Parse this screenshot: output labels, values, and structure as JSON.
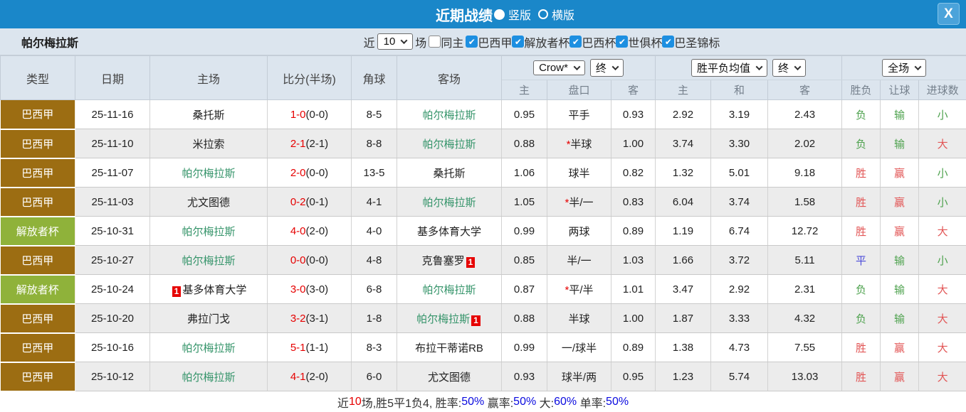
{
  "titlebar": {
    "title": "近期战绩",
    "radio_vertical": "竖版",
    "radio_horizontal": "横版",
    "vertical_selected": true,
    "close_label": "X"
  },
  "filter": {
    "team": "帕尔梅拉斯",
    "near_label": "近",
    "near_value": "10",
    "games_label": "场",
    "same_home_label": "同主",
    "same_home_checked": false,
    "leagues": [
      {
        "label": "巴西甲",
        "checked": true
      },
      {
        "label": "解放者杯",
        "checked": true
      },
      {
        "label": "巴西杯",
        "checked": true
      },
      {
        "label": "世俱杯",
        "checked": true
      },
      {
        "label": "巴圣锦标",
        "checked": true
      }
    ]
  },
  "table": {
    "left_headers": [
      "类型",
      "日期",
      "主场",
      "比分(半场)",
      "角球",
      "客场"
    ],
    "selectors": {
      "odds_company": "Crow*",
      "odds_time": "终",
      "europe": "胜平负均值",
      "europe_time": "终",
      "scope": "全场"
    },
    "sub_headers": [
      "主",
      "盘口",
      "客",
      "主",
      "和",
      "客",
      "胜负",
      "让球",
      "进球数"
    ],
    "rows": [
      {
        "type": "巴西甲",
        "type_key": "league",
        "date": "25-11-16",
        "home": "桑托斯",
        "home_team": false,
        "home_badge": "",
        "score": "1-0",
        "half": "(0-0)",
        "corner": "8-5",
        "away": "帕尔梅拉斯",
        "away_team": true,
        "away_badge": "",
        "asia_home": "0.95",
        "handicap_star": "",
        "handicap": "平手",
        "asia_away": "0.93",
        "avg_home": "2.92",
        "avg_draw": "3.19",
        "avg_away": "2.43",
        "result": "负",
        "handicap_result": "输",
        "goals": "小"
      },
      {
        "type": "巴西甲",
        "type_key": "league",
        "date": "25-11-10",
        "home": "米拉索",
        "home_team": false,
        "home_badge": "",
        "score": "2-1",
        "half": "(2-1)",
        "corner": "8-8",
        "away": "帕尔梅拉斯",
        "away_team": true,
        "away_badge": "",
        "asia_home": "0.88",
        "handicap_star": "*",
        "handicap": "半球",
        "asia_away": "1.00",
        "avg_home": "3.74",
        "avg_draw": "3.30",
        "avg_away": "2.02",
        "result": "负",
        "handicap_result": "输",
        "goals": "大"
      },
      {
        "type": "巴西甲",
        "type_key": "league",
        "date": "25-11-07",
        "home": "帕尔梅拉斯",
        "home_team": true,
        "home_badge": "",
        "score": "2-0",
        "half": "(0-0)",
        "corner": "13-5",
        "away": "桑托斯",
        "away_team": false,
        "away_badge": "",
        "asia_home": "1.06",
        "handicap_star": "",
        "handicap": "球半",
        "asia_away": "0.82",
        "avg_home": "1.32",
        "avg_draw": "5.01",
        "avg_away": "9.18",
        "result": "胜",
        "handicap_result": "赢",
        "goals": "小"
      },
      {
        "type": "巴西甲",
        "type_key": "league",
        "date": "25-11-03",
        "home": "尤文图德",
        "home_team": false,
        "home_badge": "",
        "score": "0-2",
        "half": "(0-1)",
        "corner": "4-1",
        "away": "帕尔梅拉斯",
        "away_team": true,
        "away_badge": "",
        "asia_home": "1.05",
        "handicap_star": "*",
        "handicap": "半/一",
        "asia_away": "0.83",
        "avg_home": "6.04",
        "avg_draw": "3.74",
        "avg_away": "1.58",
        "result": "胜",
        "handicap_result": "赢",
        "goals": "小"
      },
      {
        "type": "解放者杯",
        "type_key": "cup",
        "date": "25-10-31",
        "home": "帕尔梅拉斯",
        "home_team": true,
        "home_badge": "",
        "score": "4-0",
        "half": "(2-0)",
        "corner": "4-0",
        "away": "基多体育大学",
        "away_team": false,
        "away_badge": "",
        "asia_home": "0.99",
        "handicap_star": "",
        "handicap": "两球",
        "asia_away": "0.89",
        "avg_home": "1.19",
        "avg_draw": "6.74",
        "avg_away": "12.72",
        "result": "胜",
        "handicap_result": "赢",
        "goals": "大"
      },
      {
        "type": "巴西甲",
        "type_key": "league",
        "date": "25-10-27",
        "home": "帕尔梅拉斯",
        "home_team": true,
        "home_badge": "",
        "score": "0-0",
        "half": "(0-0)",
        "corner": "4-8",
        "away": "克鲁塞罗",
        "away_team": false,
        "away_badge": "1",
        "asia_home": "0.85",
        "handicap_star": "",
        "handicap": "半/一",
        "asia_away": "1.03",
        "avg_home": "1.66",
        "avg_draw": "3.72",
        "avg_away": "5.11",
        "result": "平",
        "handicap_result": "输",
        "goals": "小"
      },
      {
        "type": "解放者杯",
        "type_key": "cup",
        "date": "25-10-24",
        "home": "基多体育大学",
        "home_team": false,
        "home_badge": "1",
        "score": "3-0",
        "half": "(3-0)",
        "corner": "6-8",
        "away": "帕尔梅拉斯",
        "away_team": true,
        "away_badge": "",
        "asia_home": "0.87",
        "handicap_star": "*",
        "handicap": "平/半",
        "asia_away": "1.01",
        "avg_home": "3.47",
        "avg_draw": "2.92",
        "avg_away": "2.31",
        "result": "负",
        "handicap_result": "输",
        "goals": "大"
      },
      {
        "type": "巴西甲",
        "type_key": "league",
        "date": "25-10-20",
        "home": "弗拉门戈",
        "home_team": false,
        "home_badge": "",
        "score": "3-2",
        "half": "(3-1)",
        "corner": "1-8",
        "away": "帕尔梅拉斯",
        "away_team": true,
        "away_badge": "1",
        "asia_home": "0.88",
        "handicap_star": "",
        "handicap": "半球",
        "asia_away": "1.00",
        "avg_home": "1.87",
        "avg_draw": "3.33",
        "avg_away": "4.32",
        "result": "负",
        "handicap_result": "输",
        "goals": "大"
      },
      {
        "type": "巴西甲",
        "type_key": "league",
        "date": "25-10-16",
        "home": "帕尔梅拉斯",
        "home_team": true,
        "home_badge": "",
        "score": "5-1",
        "half": "(1-1)",
        "corner": "8-3",
        "away": "布拉干蒂诺RB",
        "away_team": false,
        "away_badge": "",
        "asia_home": "0.99",
        "handicap_star": "",
        "handicap": "一/球半",
        "asia_away": "0.89",
        "avg_home": "1.38",
        "avg_draw": "4.73",
        "avg_away": "7.55",
        "result": "胜",
        "handicap_result": "赢",
        "goals": "大"
      },
      {
        "type": "巴西甲",
        "type_key": "league",
        "date": "25-10-12",
        "home": "帕尔梅拉斯",
        "home_team": true,
        "home_badge": "",
        "score": "4-1",
        "half": "(2-0)",
        "corner": "6-0",
        "away": "尤文图德",
        "away_team": false,
        "away_badge": "",
        "asia_home": "0.93",
        "handicap_star": "",
        "handicap": "球半/两",
        "asia_away": "0.95",
        "avg_home": "1.23",
        "avg_draw": "5.74",
        "avg_away": "13.03",
        "result": "胜",
        "handicap_result": "赢",
        "goals": "大"
      }
    ]
  },
  "footer": {
    "segments": [
      {
        "text": "近",
        "color": "black"
      },
      {
        "text": "10",
        "color": "red"
      },
      {
        "text": "场,胜5平1负4, ",
        "color": "black"
      },
      {
        "text": "胜率:",
        "color": "black"
      },
      {
        "text": "50%",
        "color": "blue"
      },
      {
        "text": " 赢率:",
        "color": "black"
      },
      {
        "text": "50%",
        "color": "blue"
      },
      {
        "text": " 大:",
        "color": "black"
      },
      {
        "text": "60%",
        "color": "blue"
      },
      {
        "text": " 单率:",
        "color": "black"
      },
      {
        "text": "50%",
        "color": "blue"
      }
    ]
  },
  "colors": {
    "topbar_blue": "#1a87c9",
    "close_button_blue": "#4ba3da",
    "panel_bg": "#dce5ee",
    "league_badge_gold": "#9c6d12",
    "cup_badge_green": "#8fb23a",
    "team_green": "#35946a",
    "score_red": "#e60000",
    "win_red": "#e25555",
    "lose_green": "#4ea24e",
    "draw_blue": "#4c4cd9",
    "stat_blue": "#0a0adf",
    "asia_cell_cream": "#faf4e6",
    "avg_cell_blue": "#e9f2f8",
    "checkbox_blue": "#1d8fe1"
  }
}
